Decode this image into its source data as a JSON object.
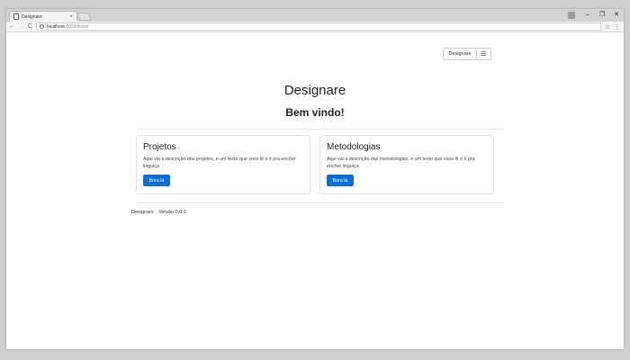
{
  "browser": {
    "tab_title": "Designare",
    "tab_close": "×",
    "url_host": "localhost",
    "url_path": ":8000/inicio/",
    "controls": {
      "minimize": "–",
      "restore": "❐",
      "close": "✕"
    },
    "nav": {
      "back": "←",
      "forward": "→",
      "reload": "C"
    },
    "star": "☆",
    "menu": "⋮"
  },
  "header": {
    "brand_button": "Designare",
    "menu_button": "☰"
  },
  "main": {
    "title": "Designare",
    "welcome": "Bem vindo!",
    "cards": [
      {
        "title": "Projetos",
        "text": "Aqui vai a descrição dos projetos, e um texto que voce lê e é pra encher linguiça",
        "button": "Bora lá"
      },
      {
        "title": "Metodologias",
        "text": "Aqui vai a descrição das metodologias, e um texto que voce lê e é pra encher linguiça",
        "button": "Bora lá"
      }
    ]
  },
  "footer": {
    "text": "Designare - Versão 0.0.1"
  },
  "colors": {
    "primary": "#0a6fd6",
    "page_background": "#ffffff",
    "frame": "#cfcfcf"
  }
}
